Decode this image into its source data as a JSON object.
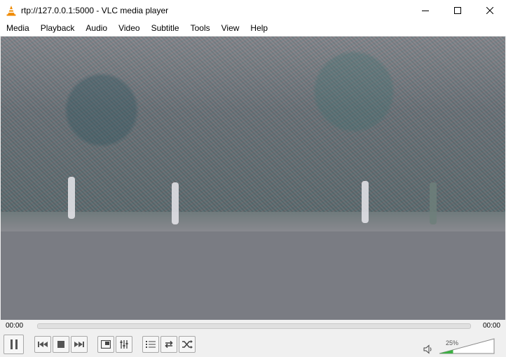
{
  "window": {
    "title": "rtp://127.0.0.1:5000 - VLC media player",
    "icon": "vlc-cone-icon",
    "controls": [
      "minimize-icon",
      "maximize-icon",
      "close-icon"
    ]
  },
  "menu": [
    {
      "label": "Media"
    },
    {
      "label": "Playback"
    },
    {
      "label": "Audio"
    },
    {
      "label": "Video"
    },
    {
      "label": "Subtitle"
    },
    {
      "label": "Tools"
    },
    {
      "label": "View"
    },
    {
      "label": "Help"
    }
  ],
  "playback": {
    "elapsed": "00:00",
    "total": "00:00",
    "progress": 0
  },
  "controls": {
    "buttons": [
      "pause-icon",
      "previous-icon",
      "stop-icon",
      "next-icon",
      "fullscreen-icon",
      "extended-settings-icon",
      "playlist-icon",
      "loop-icon",
      "shuffle-icon"
    ]
  },
  "volume": {
    "label": "25%",
    "level": 0.25,
    "icon": "speaker-icon"
  },
  "colors": {
    "volume_fill": "#3cb043"
  }
}
